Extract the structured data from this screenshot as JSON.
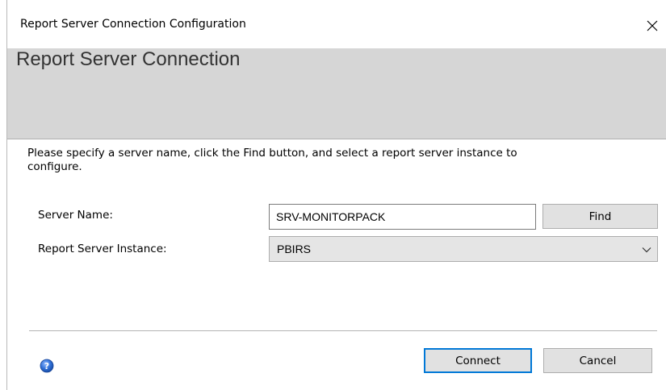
{
  "window": {
    "title": "Report Server Connection Configuration",
    "close_glyph": "✕"
  },
  "header": {
    "title": "Report Server Connection"
  },
  "instructions": "Please specify a server name, click the Find button, and select a report server instance to configure.",
  "form": {
    "server_name_label": "Server Name:",
    "server_name_value": "SRV-MONITORPACK",
    "find_button": "Find",
    "instance_label": "Report Server Instance:",
    "instance_value": "PBIRS"
  },
  "footer": {
    "connect_button": "Connect",
    "cancel_button": "Cancel",
    "help_icon": "help-icon"
  },
  "colors": {
    "header_band": "#d6d6d6",
    "button_face": "#e1e1e1",
    "focus_border": "#0078d7"
  }
}
